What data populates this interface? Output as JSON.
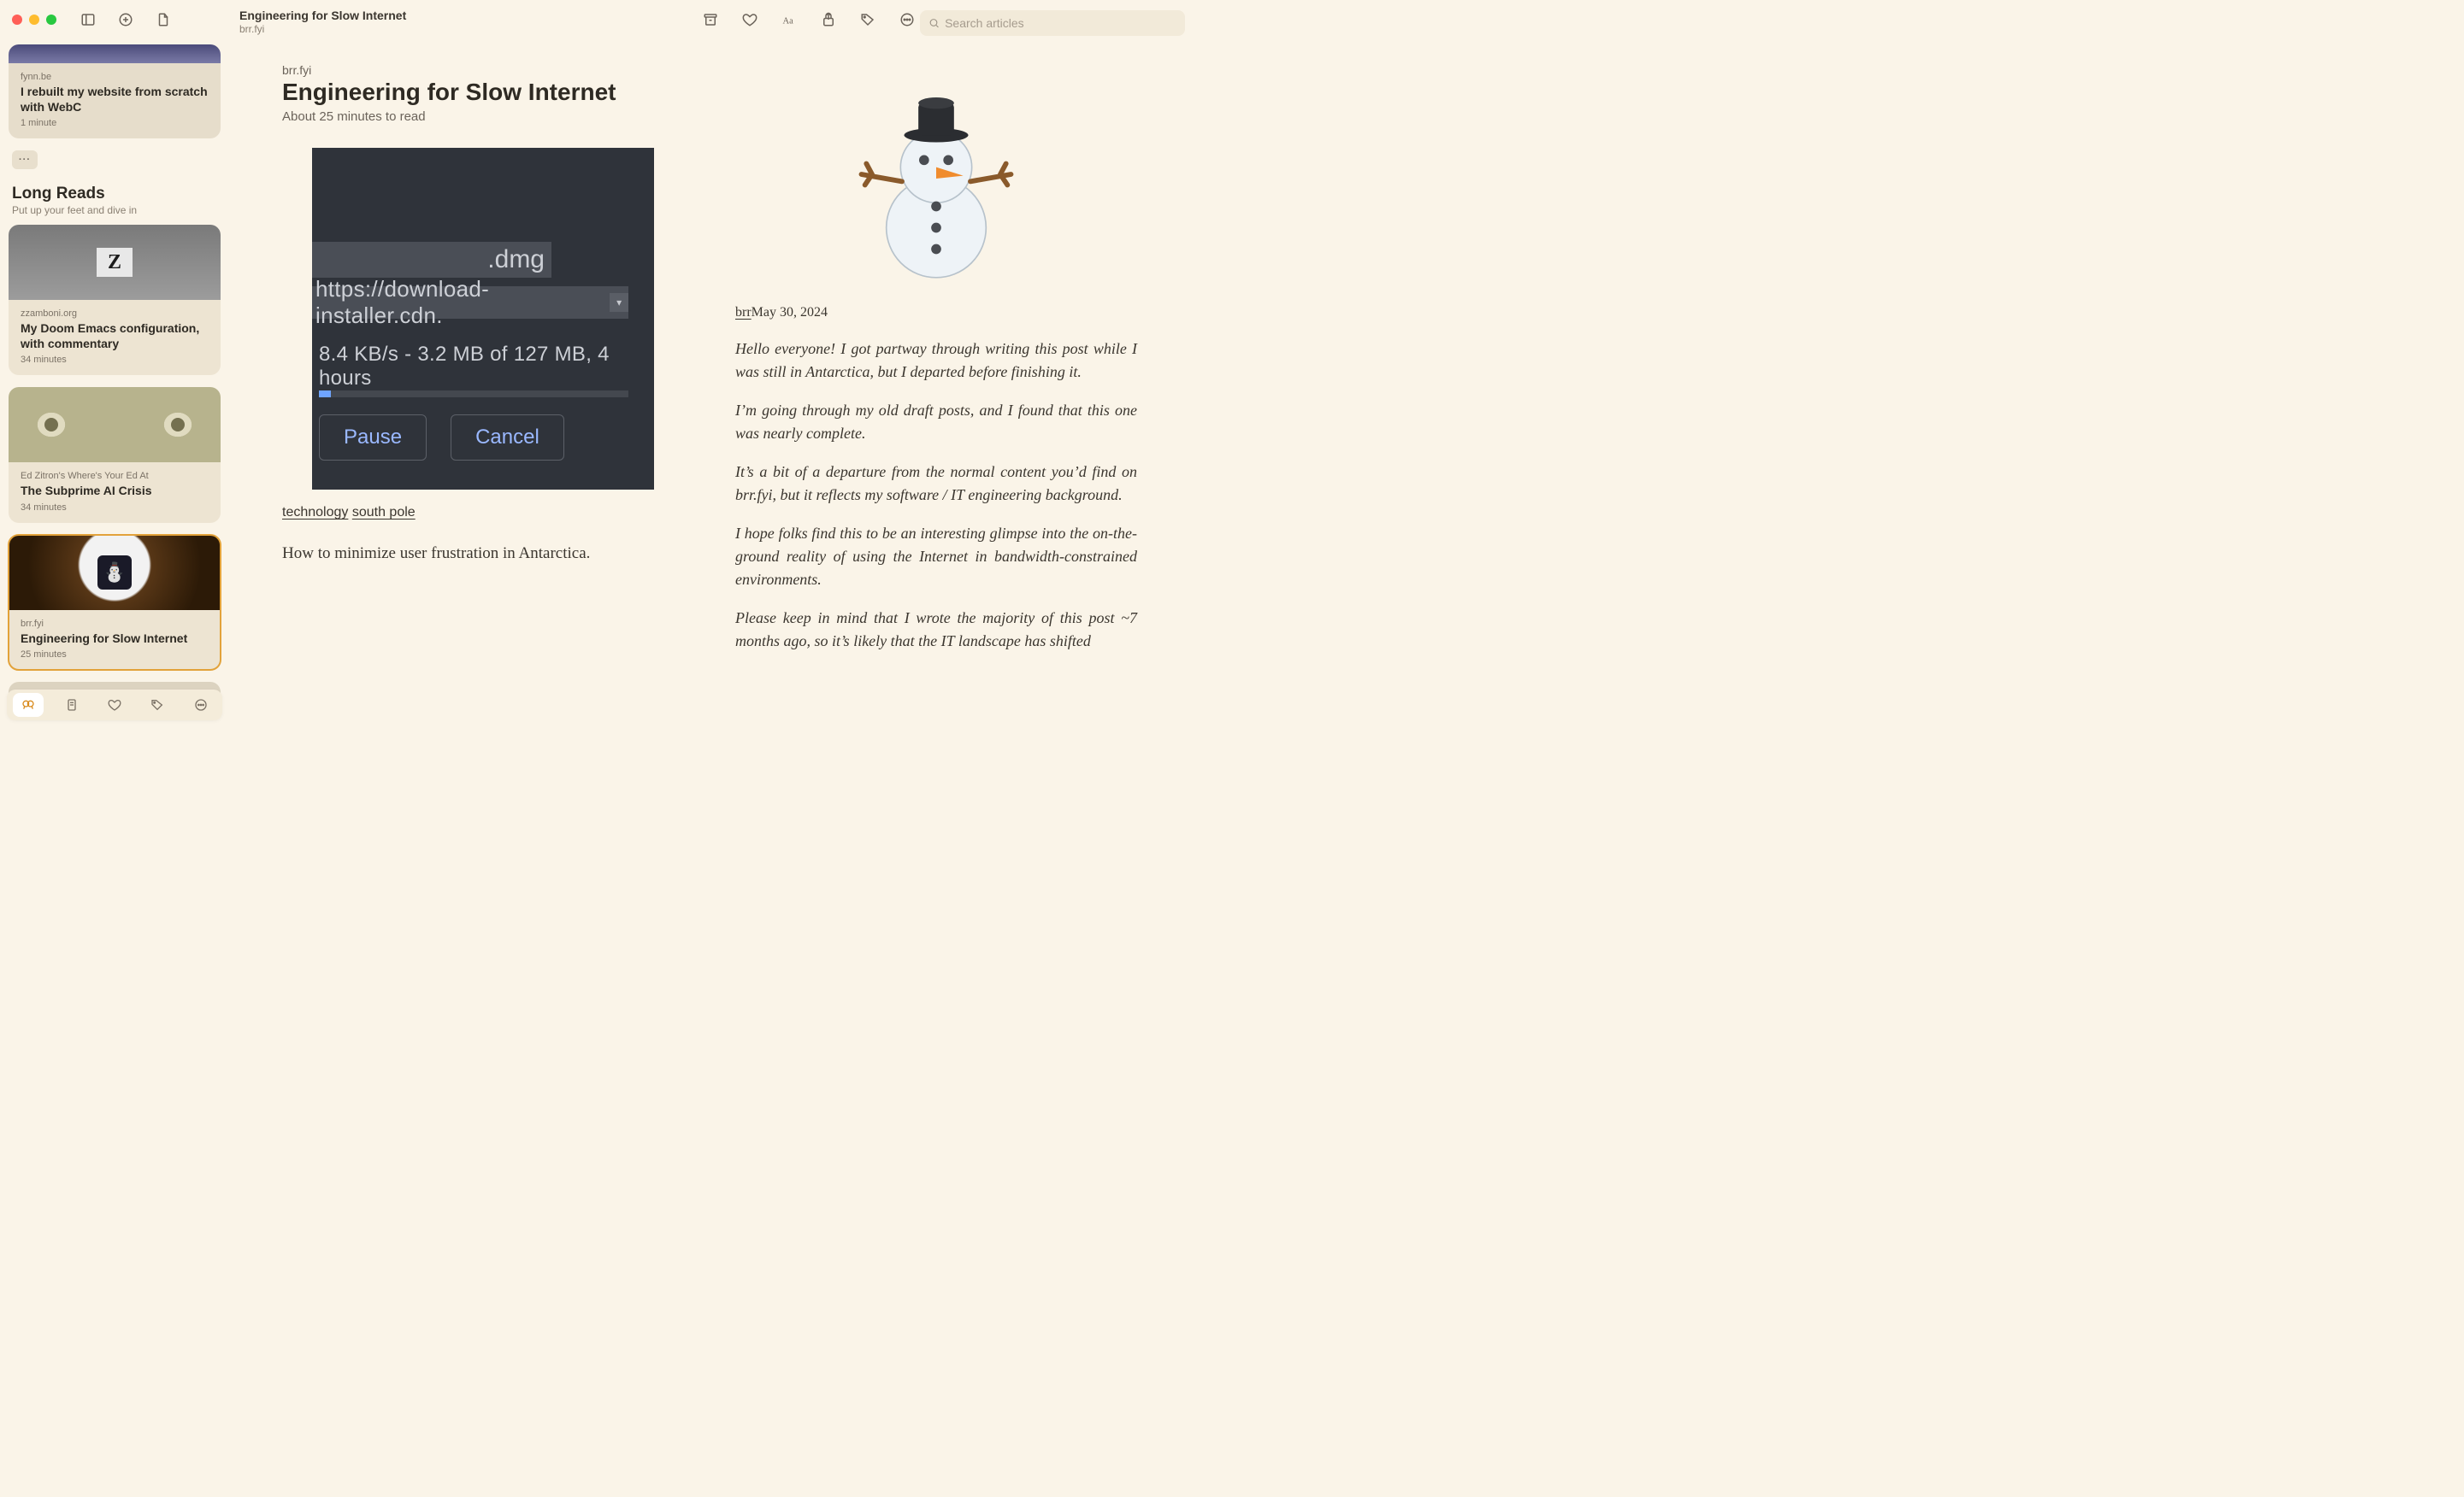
{
  "header": {
    "title": "Engineering for Slow Internet",
    "subtitle": "brr.fyi",
    "search_placeholder": "Search articles"
  },
  "sidebar": {
    "more_label": "···",
    "section_title": "Long Reads",
    "section_sub": "Put up your feet and dive in",
    "cards": [
      {
        "source": "fynn.be",
        "title": "I rebuilt my website from scratch with WebC",
        "time": "1 minute"
      },
      {
        "source": "zzamboni.org",
        "title": "My Doom Emacs configuration, with commentary",
        "time": "34 minutes"
      },
      {
        "source": "Ed Zitron's Where's Your Ed At",
        "title": "The Subprime AI Crisis",
        "time": "34 minutes"
      },
      {
        "source": "brr.fyi",
        "title": "Engineering for Slow Internet",
        "time": "25 minutes"
      }
    ]
  },
  "article": {
    "source": "brr.fyi",
    "title": "Engineering for Slow Internet",
    "readtime": "About 25 minutes to read",
    "embed": {
      "filename": ".dmg",
      "url": "https://download-installer.cdn.",
      "status": "8.4 KB/s - 3.2 MB of 127 MB, 4 hours",
      "pause": "Pause",
      "cancel": "Cancel"
    },
    "tags": [
      "technology",
      "south pole"
    ],
    "lead": "How to minimize user frustration in Antarctica.",
    "byline_author": "brr",
    "byline_date": "May 30, 2024",
    "paras": [
      "Hello everyone! I got partway through writing this post while I was still in Antarctica, but I departed before finishing it.",
      "I’m going through my old draft posts, and I found that this one was nearly complete.",
      "It’s a bit of a departure from the normal content you’d find on brr.fyi, but it reflects my software / IT engi­neer­ing back­ground.",
      "I hope folks find this to be an interesting glimpse into the on-the-ground reality of using the Internet in bandwidth-con­strained environments.",
      "Please keep in mind that I wrote the majority of this post ~7 months ago, so it’s likely that the IT landscape has shifted"
    ]
  }
}
